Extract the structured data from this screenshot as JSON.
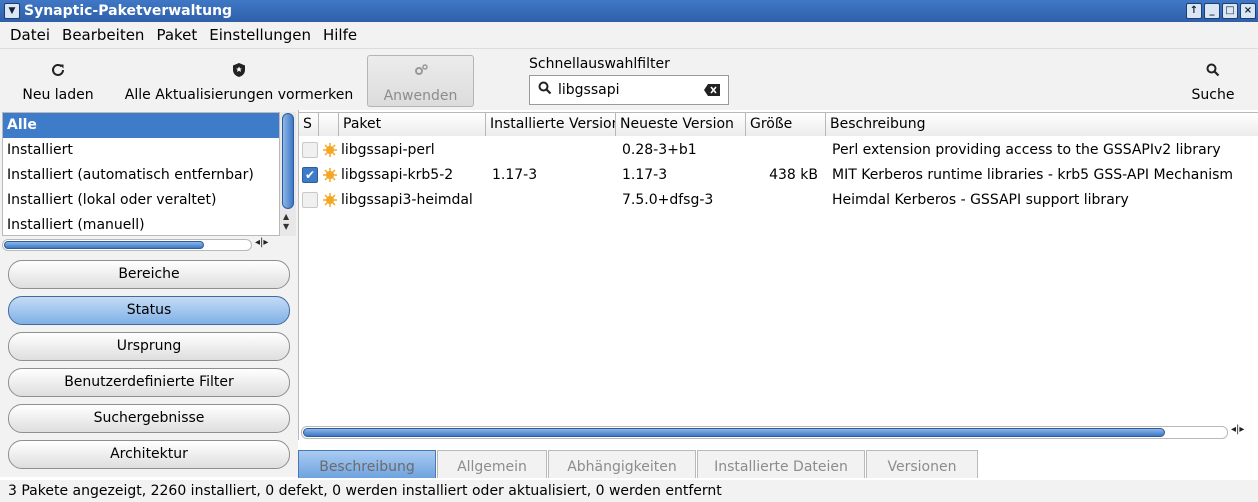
{
  "window": {
    "title": "Synaptic-Paketverwaltung",
    "buttons": [
      "↑",
      "_",
      "□",
      "×"
    ]
  },
  "menubar": {
    "items": [
      "Datei",
      "Bearbeiten",
      "Paket",
      "Einstellungen",
      "Hilfe"
    ]
  },
  "toolbar": {
    "reload_label": "Neu laden",
    "mark_upgrades_label": "Alle Aktualisierungen vormerken",
    "apply_label": "Anwenden",
    "search_label": "Suche",
    "quickfilter_label": "Schnellauswahlfilter",
    "quickfilter_value": "libgssapi"
  },
  "filters": {
    "items": [
      "Alle",
      "Installiert",
      "Installiert (automatisch entfernbar)",
      "Installiert (lokal oder veraltet)",
      "Installiert (manuell)"
    ],
    "selected": "Alle"
  },
  "groups": {
    "items": [
      "Bereiche",
      "Status",
      "Ursprung",
      "Benutzerdefinierte Filter",
      "Suchergebnisse",
      "Architektur"
    ],
    "active": "Status"
  },
  "packages": {
    "columns": [
      "S",
      "",
      "Paket",
      "Installierte Version",
      "Neueste Version",
      "Größe",
      "Beschreibung"
    ],
    "rows": [
      {
        "name": "libgssapi-perl",
        "installed": "",
        "latest": "0.28-3+b1",
        "size": "",
        "description": "Perl extension providing access to the GSSAPIv2 library",
        "checked": false
      },
      {
        "name": "libgssapi-krb5-2",
        "installed": "1.17-3",
        "latest": "1.17-3",
        "size": "438 kB",
        "description": "MIT Kerberos runtime libraries - krb5 GSS-API Mechanism",
        "checked": true
      },
      {
        "name": "libgssapi3-heimdal",
        "installed": "",
        "latest": "7.5.0+dfsg-3",
        "size": "",
        "description": "Heimdal Kerberos - GSSAPI support library",
        "checked": false
      }
    ]
  },
  "detail_tabs": {
    "items": [
      "Beschreibung",
      "Allgemein",
      "Abhängigkeiten",
      "Installierte Dateien",
      "Versionen"
    ],
    "active": "Beschreibung"
  },
  "statusbar": {
    "text": "3 Pakete angezeigt, 2260 installiert, 0 defekt, 0 werden installiert oder aktualisiert, 0 werden entfernt"
  },
  "colors": {
    "accent": "#3e7bc8",
    "titlebar": "#3f78c6",
    "package_star": "#f5a623"
  }
}
